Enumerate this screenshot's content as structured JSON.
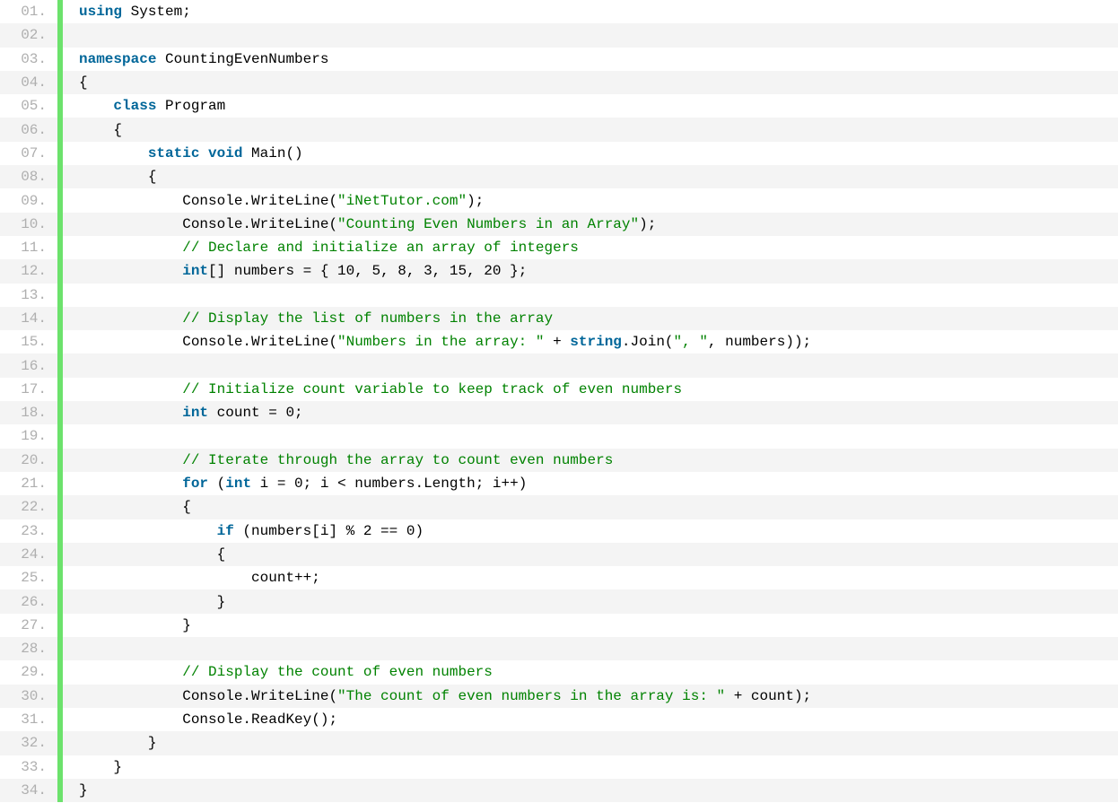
{
  "code": {
    "lines": [
      {
        "num": "01.",
        "tokens": [
          {
            "t": "kw",
            "v": "using"
          },
          {
            "t": "plain",
            "v": " System;"
          }
        ]
      },
      {
        "num": "02.",
        "tokens": [
          {
            "t": "plain",
            "v": " "
          }
        ]
      },
      {
        "num": "03.",
        "tokens": [
          {
            "t": "kw",
            "v": "namespace"
          },
          {
            "t": "plain",
            "v": " CountingEvenNumbers"
          }
        ]
      },
      {
        "num": "04.",
        "tokens": [
          {
            "t": "plain",
            "v": "{"
          }
        ]
      },
      {
        "num": "05.",
        "tokens": [
          {
            "t": "plain",
            "v": "    "
          },
          {
            "t": "kw",
            "v": "class"
          },
          {
            "t": "plain",
            "v": " Program"
          }
        ]
      },
      {
        "num": "06.",
        "tokens": [
          {
            "t": "plain",
            "v": "    {"
          }
        ]
      },
      {
        "num": "07.",
        "tokens": [
          {
            "t": "plain",
            "v": "        "
          },
          {
            "t": "kw",
            "v": "static"
          },
          {
            "t": "plain",
            "v": " "
          },
          {
            "t": "kw",
            "v": "void"
          },
          {
            "t": "plain",
            "v": " Main()"
          }
        ]
      },
      {
        "num": "08.",
        "tokens": [
          {
            "t": "plain",
            "v": "        {"
          }
        ]
      },
      {
        "num": "09.",
        "tokens": [
          {
            "t": "plain",
            "v": "            Console.WriteLine("
          },
          {
            "t": "str",
            "v": "\"iNetTutor.com\""
          },
          {
            "t": "plain",
            "v": ");"
          }
        ]
      },
      {
        "num": "10.",
        "tokens": [
          {
            "t": "plain",
            "v": "            Console.WriteLine("
          },
          {
            "t": "str",
            "v": "\"Counting Even Numbers in an Array\""
          },
          {
            "t": "plain",
            "v": ");"
          }
        ]
      },
      {
        "num": "11.",
        "tokens": [
          {
            "t": "plain",
            "v": "            "
          },
          {
            "t": "comment",
            "v": "// Declare and initialize an array of integers"
          }
        ]
      },
      {
        "num": "12.",
        "tokens": [
          {
            "t": "plain",
            "v": "            "
          },
          {
            "t": "kw",
            "v": "int"
          },
          {
            "t": "plain",
            "v": "[] numbers = { 10, 5, 8, 3, 15, 20 };"
          }
        ]
      },
      {
        "num": "13.",
        "tokens": [
          {
            "t": "plain",
            "v": " "
          }
        ]
      },
      {
        "num": "14.",
        "tokens": [
          {
            "t": "plain",
            "v": "            "
          },
          {
            "t": "comment",
            "v": "// Display the list of numbers in the array"
          }
        ]
      },
      {
        "num": "15.",
        "tokens": [
          {
            "t": "plain",
            "v": "            Console.WriteLine("
          },
          {
            "t": "str",
            "v": "\"Numbers in the array: \""
          },
          {
            "t": "plain",
            "v": " + "
          },
          {
            "t": "kw",
            "v": "string"
          },
          {
            "t": "plain",
            "v": ".Join("
          },
          {
            "t": "str",
            "v": "\", \""
          },
          {
            "t": "plain",
            "v": ", numbers));"
          }
        ]
      },
      {
        "num": "16.",
        "tokens": [
          {
            "t": "plain",
            "v": " "
          }
        ]
      },
      {
        "num": "17.",
        "tokens": [
          {
            "t": "plain",
            "v": "            "
          },
          {
            "t": "comment",
            "v": "// Initialize count variable to keep track of even numbers"
          }
        ]
      },
      {
        "num": "18.",
        "tokens": [
          {
            "t": "plain",
            "v": "            "
          },
          {
            "t": "kw",
            "v": "int"
          },
          {
            "t": "plain",
            "v": " count = 0;"
          }
        ]
      },
      {
        "num": "19.",
        "tokens": [
          {
            "t": "plain",
            "v": " "
          }
        ]
      },
      {
        "num": "20.",
        "tokens": [
          {
            "t": "plain",
            "v": "            "
          },
          {
            "t": "comment",
            "v": "// Iterate through the array to count even numbers"
          }
        ]
      },
      {
        "num": "21.",
        "tokens": [
          {
            "t": "plain",
            "v": "            "
          },
          {
            "t": "kw",
            "v": "for"
          },
          {
            "t": "plain",
            "v": " ("
          },
          {
            "t": "kw",
            "v": "int"
          },
          {
            "t": "plain",
            "v": " i = 0; i < numbers.Length; i++)"
          }
        ]
      },
      {
        "num": "22.",
        "tokens": [
          {
            "t": "plain",
            "v": "            {"
          }
        ]
      },
      {
        "num": "23.",
        "tokens": [
          {
            "t": "plain",
            "v": "                "
          },
          {
            "t": "kw",
            "v": "if"
          },
          {
            "t": "plain",
            "v": " (numbers[i] % 2 == 0)"
          }
        ]
      },
      {
        "num": "24.",
        "tokens": [
          {
            "t": "plain",
            "v": "                {"
          }
        ]
      },
      {
        "num": "25.",
        "tokens": [
          {
            "t": "plain",
            "v": "                    count++;"
          }
        ]
      },
      {
        "num": "26.",
        "tokens": [
          {
            "t": "plain",
            "v": "                }"
          }
        ]
      },
      {
        "num": "27.",
        "tokens": [
          {
            "t": "plain",
            "v": "            }"
          }
        ]
      },
      {
        "num": "28.",
        "tokens": [
          {
            "t": "plain",
            "v": " "
          }
        ]
      },
      {
        "num": "29.",
        "tokens": [
          {
            "t": "plain",
            "v": "            "
          },
          {
            "t": "comment",
            "v": "// Display the count of even numbers"
          }
        ]
      },
      {
        "num": "30.",
        "tokens": [
          {
            "t": "plain",
            "v": "            Console.WriteLine("
          },
          {
            "t": "str",
            "v": "\"The count of even numbers in the array is: \""
          },
          {
            "t": "plain",
            "v": " + count);"
          }
        ]
      },
      {
        "num": "31.",
        "tokens": [
          {
            "t": "plain",
            "v": "            Console.ReadKey();"
          }
        ]
      },
      {
        "num": "32.",
        "tokens": [
          {
            "t": "plain",
            "v": "        }"
          }
        ]
      },
      {
        "num": "33.",
        "tokens": [
          {
            "t": "plain",
            "v": "    }"
          }
        ]
      },
      {
        "num": "34.",
        "tokens": [
          {
            "t": "plain",
            "v": "}"
          }
        ]
      }
    ]
  }
}
